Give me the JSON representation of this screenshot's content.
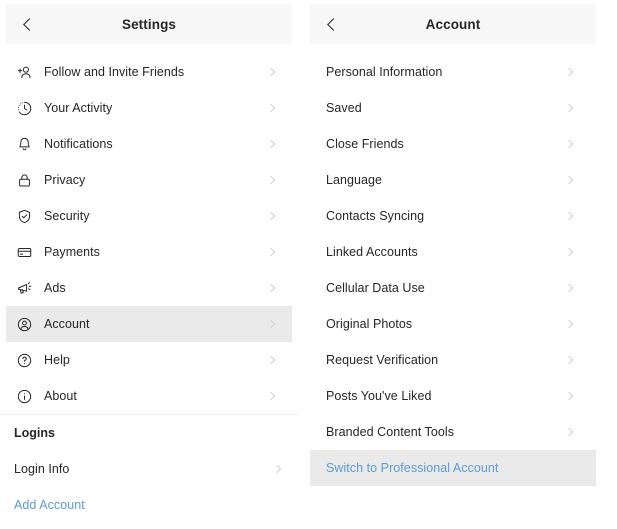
{
  "left_panel": {
    "header": {
      "title": "Settings",
      "back_icon": "chevron-left-icon"
    },
    "items": [
      {
        "label": "Follow and Invite Friends",
        "icon": "person-add-icon",
        "chevron": true,
        "selected": false
      },
      {
        "label": "Your Activity",
        "icon": "activity-clock-icon",
        "chevron": true,
        "selected": false
      },
      {
        "label": "Notifications",
        "icon": "bell-icon",
        "chevron": true,
        "selected": false
      },
      {
        "label": "Privacy",
        "icon": "lock-icon",
        "chevron": true,
        "selected": false
      },
      {
        "label": "Security",
        "icon": "shield-check-icon",
        "chevron": true,
        "selected": false
      },
      {
        "label": "Payments",
        "icon": "credit-card-icon",
        "chevron": true,
        "selected": false
      },
      {
        "label": "Ads",
        "icon": "megaphone-icon",
        "chevron": true,
        "selected": false
      },
      {
        "label": "Account",
        "icon": "user-circle-icon",
        "chevron": true,
        "selected": true
      },
      {
        "label": "Help",
        "icon": "question-circle-icon",
        "chevron": true,
        "selected": false
      },
      {
        "label": "About",
        "icon": "info-circle-icon",
        "chevron": true,
        "selected": false
      }
    ],
    "section": {
      "title": "Logins",
      "items": [
        {
          "label": "Login Info",
          "chevron": true,
          "link": false
        },
        {
          "label": "Add Account",
          "chevron": false,
          "link": true
        }
      ]
    }
  },
  "right_panel": {
    "header": {
      "title": "Account",
      "back_icon": "chevron-left-icon"
    },
    "items": [
      {
        "label": "Personal Information",
        "chevron": true,
        "selected": false,
        "link": false
      },
      {
        "label": "Saved",
        "chevron": true,
        "selected": false,
        "link": false
      },
      {
        "label": "Close Friends",
        "chevron": true,
        "selected": false,
        "link": false
      },
      {
        "label": "Language",
        "chevron": true,
        "selected": false,
        "link": false
      },
      {
        "label": "Contacts Syncing",
        "chevron": true,
        "selected": false,
        "link": false
      },
      {
        "label": "Linked Accounts",
        "chevron": true,
        "selected": false,
        "link": false
      },
      {
        "label": "Cellular Data Use",
        "chevron": true,
        "selected": false,
        "link": false
      },
      {
        "label": "Original Photos",
        "chevron": true,
        "selected": false,
        "link": false
      },
      {
        "label": "Request Verification",
        "chevron": true,
        "selected": false,
        "link": false
      },
      {
        "label": "Posts You've Liked",
        "chevron": true,
        "selected": false,
        "link": false
      },
      {
        "label": "Branded Content Tools",
        "chevron": true,
        "selected": false,
        "link": false
      },
      {
        "label": "Switch to Professional Account",
        "chevron": false,
        "selected": true,
        "link": true
      }
    ]
  },
  "colors": {
    "text": "#262626",
    "link": "#5b9bd5",
    "header_bg": "#f7f7f7",
    "selected_bg": "#eaeaea",
    "chevron": "#d0d0d0",
    "divider": "#efefef"
  }
}
